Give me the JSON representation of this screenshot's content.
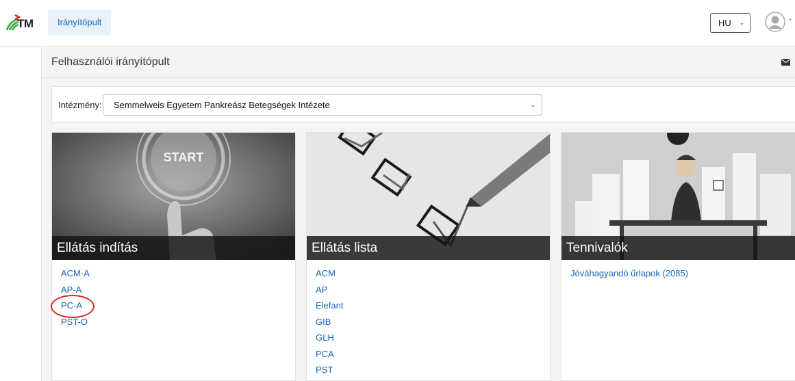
{
  "app": {
    "logo_text": "TM"
  },
  "nav": {
    "tab_dashboard": "Irányítópult"
  },
  "header": {
    "language": "HU"
  },
  "page": {
    "title": "Felhasználói irányítópult"
  },
  "institution": {
    "label": "Intézmény:",
    "selected": "Semmelweis Egyetem Pankreász Betegségek Intézete"
  },
  "cards": [
    {
      "title": "Ellátás indítás",
      "image_text": "START",
      "links": [
        "ACM-A",
        "AP-A",
        "PC-A",
        "PST-O"
      ]
    },
    {
      "title": "Ellátás lista",
      "links": [
        "ACM",
        "AP",
        "Elefant",
        "GIB",
        "GLH",
        "PCA",
        "PST"
      ]
    },
    {
      "title": "Tennivalók",
      "links": [
        "Jóváhagyandó űrlapok (2085)"
      ]
    }
  ],
  "colors": {
    "link": "#1565c0",
    "nav_tab_bg": "#e9f1fb",
    "highlight": "#d3262a",
    "logo_green": "#3aa640",
    "logo_red": "#d3262a"
  },
  "icons": {
    "mail": "envelope-icon",
    "avatar": "user-avatar-icon",
    "dropdown": "chevron-down-icon"
  }
}
